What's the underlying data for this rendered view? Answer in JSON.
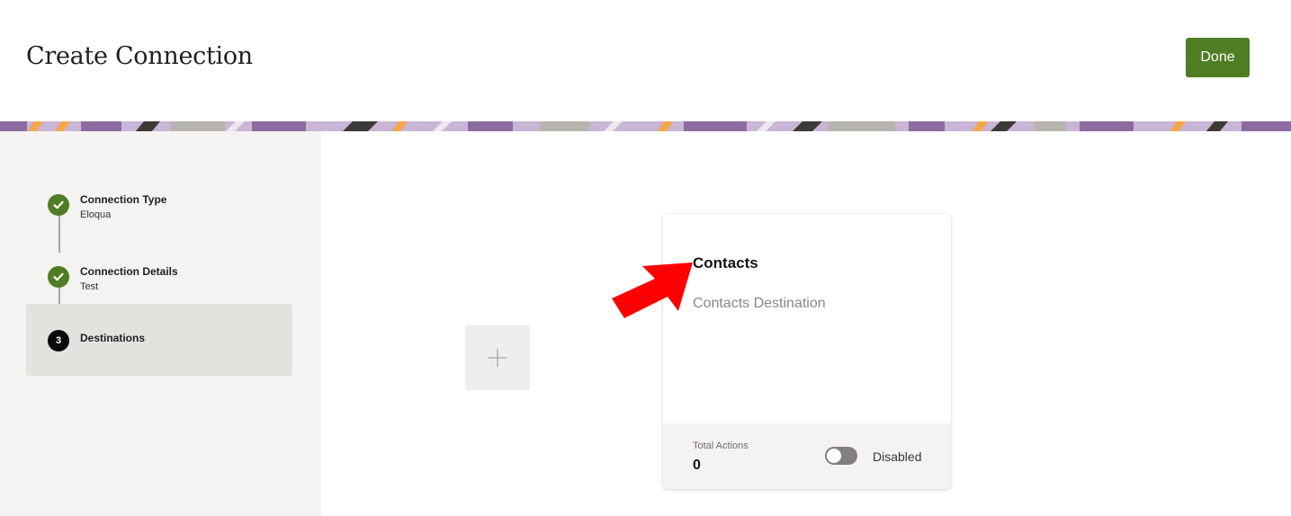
{
  "header": {
    "title": "Create Connection",
    "done_label": "Done",
    "accent_color": "#4f7d24"
  },
  "steps": [
    {
      "title": "Connection Type",
      "subtitle": "Eloqua",
      "status": "complete",
      "icon": "checkmark-icon"
    },
    {
      "title": "Connection Details",
      "subtitle": "Test",
      "status": "complete",
      "icon": "checkmark-icon"
    },
    {
      "title": "Destinations",
      "subtitle": "",
      "status": "current",
      "number": "3"
    }
  ],
  "add_destination": {
    "icon": "plus-icon"
  },
  "destination_card": {
    "title": "Contacts",
    "description": "Contacts Destination",
    "total_actions_label": "Total Actions",
    "total_actions_value": "0",
    "toggle_state_label": "Disabled",
    "enabled": false
  },
  "annotation": {
    "icon": "red-arrow-icon",
    "color": "#ff0000"
  }
}
